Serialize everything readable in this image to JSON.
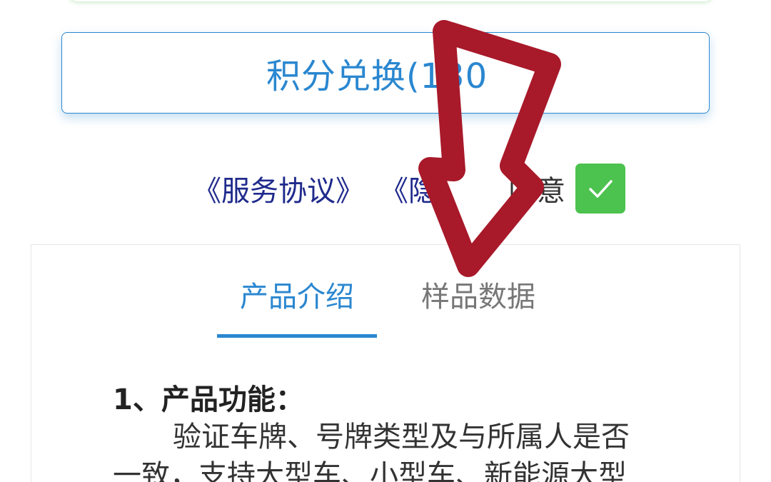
{
  "redeem": {
    "label": "积分兑换(130"
  },
  "agreement": {
    "links": [
      "《服务协议》",
      "《隐"
    ],
    "agree_text": "同意",
    "checked": true
  },
  "tabs": [
    {
      "label": "产品介绍",
      "active": true
    },
    {
      "label": "样品数据",
      "active": false
    }
  ],
  "content": {
    "heading": "1、产品功能：",
    "body": "验证车牌、号牌类型及与所属人是否一致，支持大型车、小型车、新能源大型"
  },
  "colors": {
    "accent": "#2a87d0",
    "link": "#1f2a8c",
    "checkbox": "#4cc24f",
    "annotation_arrow": "#a8192a"
  },
  "icons": {
    "checkbox": "checkmark-icon",
    "annotation": "red-arrow-icon"
  }
}
